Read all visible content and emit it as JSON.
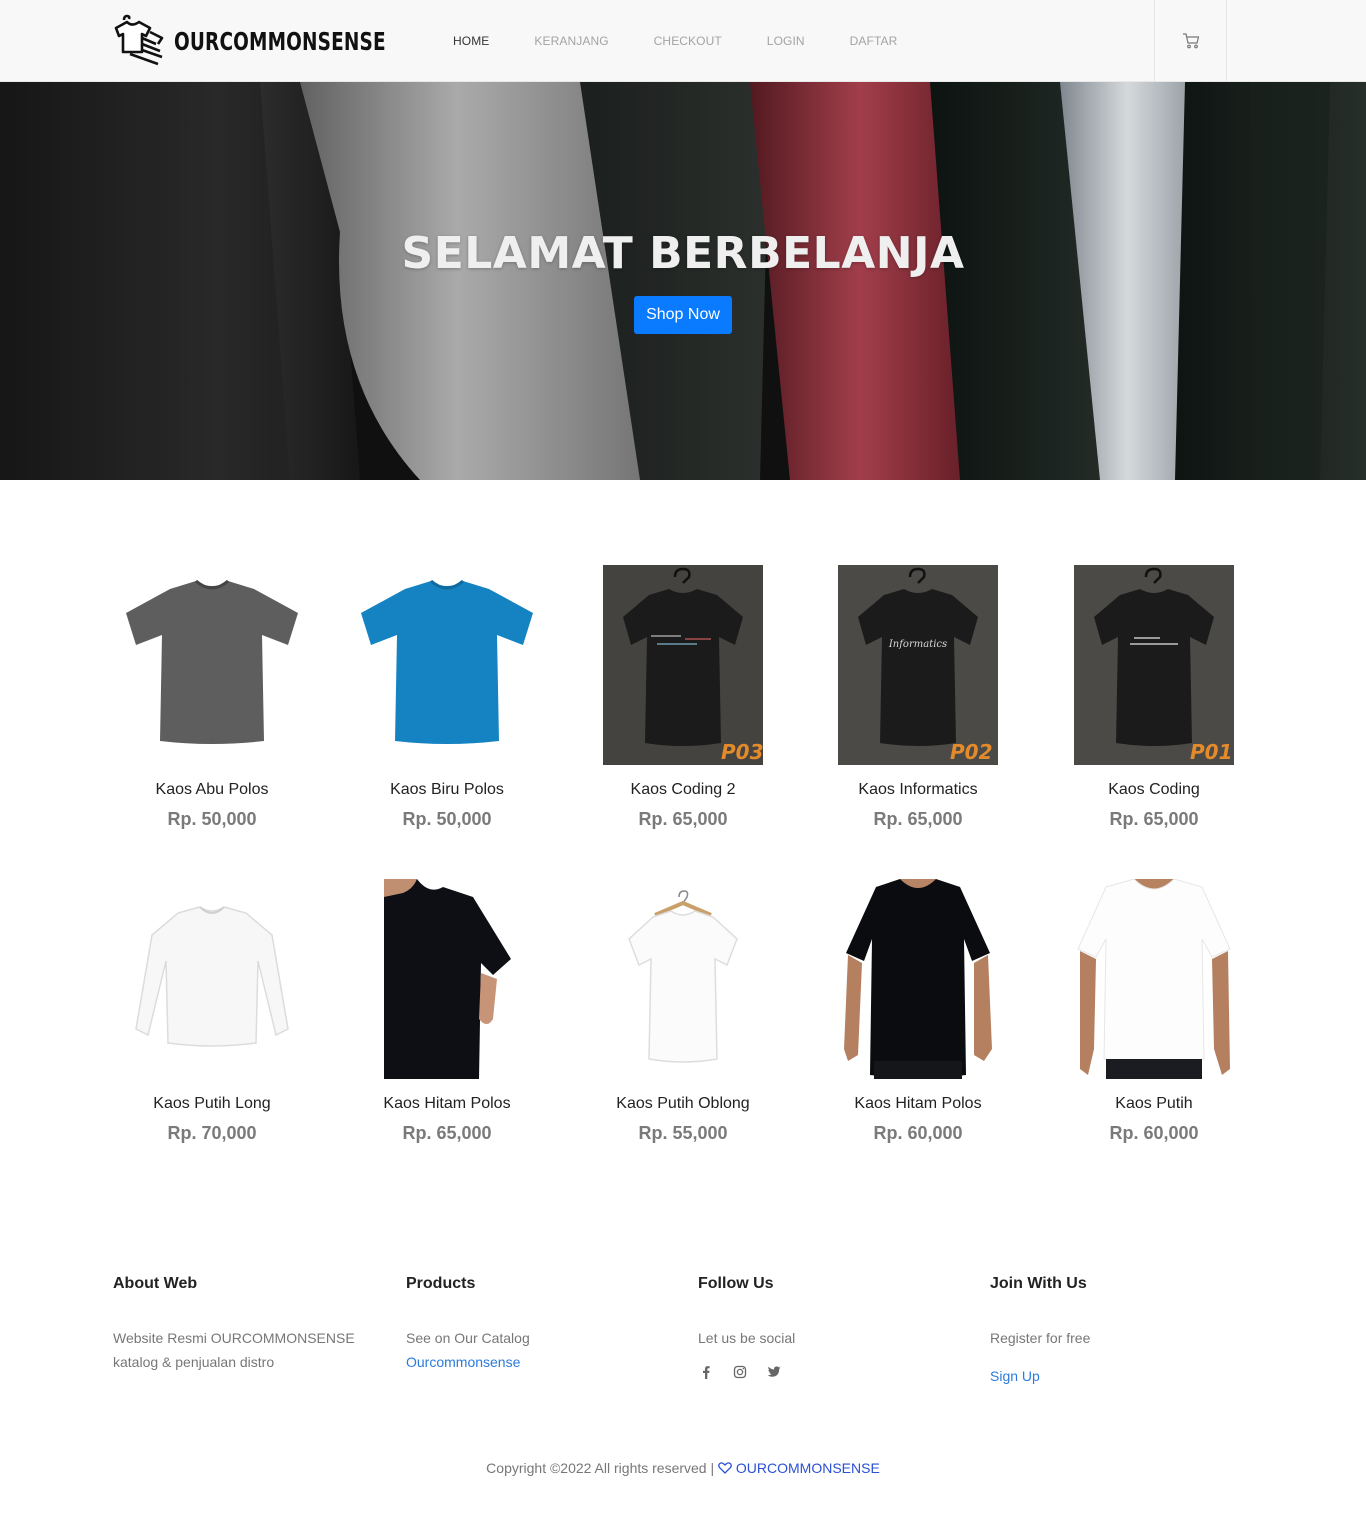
{
  "header": {
    "logo_text": "OURCOMMONSENSE",
    "nav": [
      {
        "label": "HOME",
        "active": true
      },
      {
        "label": "KERANJANG",
        "active": false
      },
      {
        "label": "CHECKOUT",
        "active": false
      },
      {
        "label": "LOGIN",
        "active": false
      },
      {
        "label": "DAFTAR",
        "active": false
      }
    ],
    "cart_icon": "cart-icon"
  },
  "hero": {
    "title": "SELAMAT BERBELANJA",
    "button_label": "Shop Now",
    "button_color": "#0a7bff"
  },
  "products": [
    {
      "name": "Kaos Abu Polos",
      "price": "Rp. 50,000",
      "image": "grey-tshirt"
    },
    {
      "name": "Kaos Biru Polos",
      "price": "Rp. 50,000",
      "image": "blue-tshirt"
    },
    {
      "name": "Kaos Coding 2",
      "price": "Rp. 65,000",
      "image": "black-hanger-tshirt",
      "code": "P03"
    },
    {
      "name": "Kaos Informatics",
      "price": "Rp. 65,000",
      "image": "black-hanger-tshirt",
      "code": "P02",
      "print": "Informatics"
    },
    {
      "name": "Kaos Coding",
      "price": "Rp. 65,000",
      "image": "black-hanger-tshirt",
      "code": "P01"
    },
    {
      "name": "Kaos Putih Long",
      "price": "Rp. 70,000",
      "image": "white-longsleeve"
    },
    {
      "name": "Kaos Hitam Polos",
      "price": "Rp. 65,000",
      "image": "black-tshirt-model-closeup"
    },
    {
      "name": "Kaos Putih Oblong",
      "price": "Rp. 55,000",
      "image": "white-tshirt-hanger"
    },
    {
      "name": "Kaos Hitam Polos",
      "price": "Rp. 60,000",
      "image": "black-tshirt-model"
    },
    {
      "name": "Kaos Putih",
      "price": "Rp. 60,000",
      "image": "white-tshirt-model"
    }
  ],
  "footer": {
    "about": {
      "title": "About Web",
      "line1": "Website Resmi OURCOMMONSENSE",
      "line2": "katalog & penjualan distro"
    },
    "products": {
      "title": "Products",
      "text": "See on Our Catalog",
      "link": "Ourcommonsense"
    },
    "follow": {
      "title": "Follow Us",
      "text": "Let us be social",
      "icons": [
        "facebook-icon",
        "instagram-icon",
        "twitter-icon"
      ]
    },
    "join": {
      "title": "Join With Us",
      "text": "Register for free",
      "link": "Sign Up"
    },
    "copyright": "Copyright ©2022 All rights reserved |",
    "copyright_brand": "OURCOMMONSENSE",
    "link_color": "#2b7bdc"
  }
}
